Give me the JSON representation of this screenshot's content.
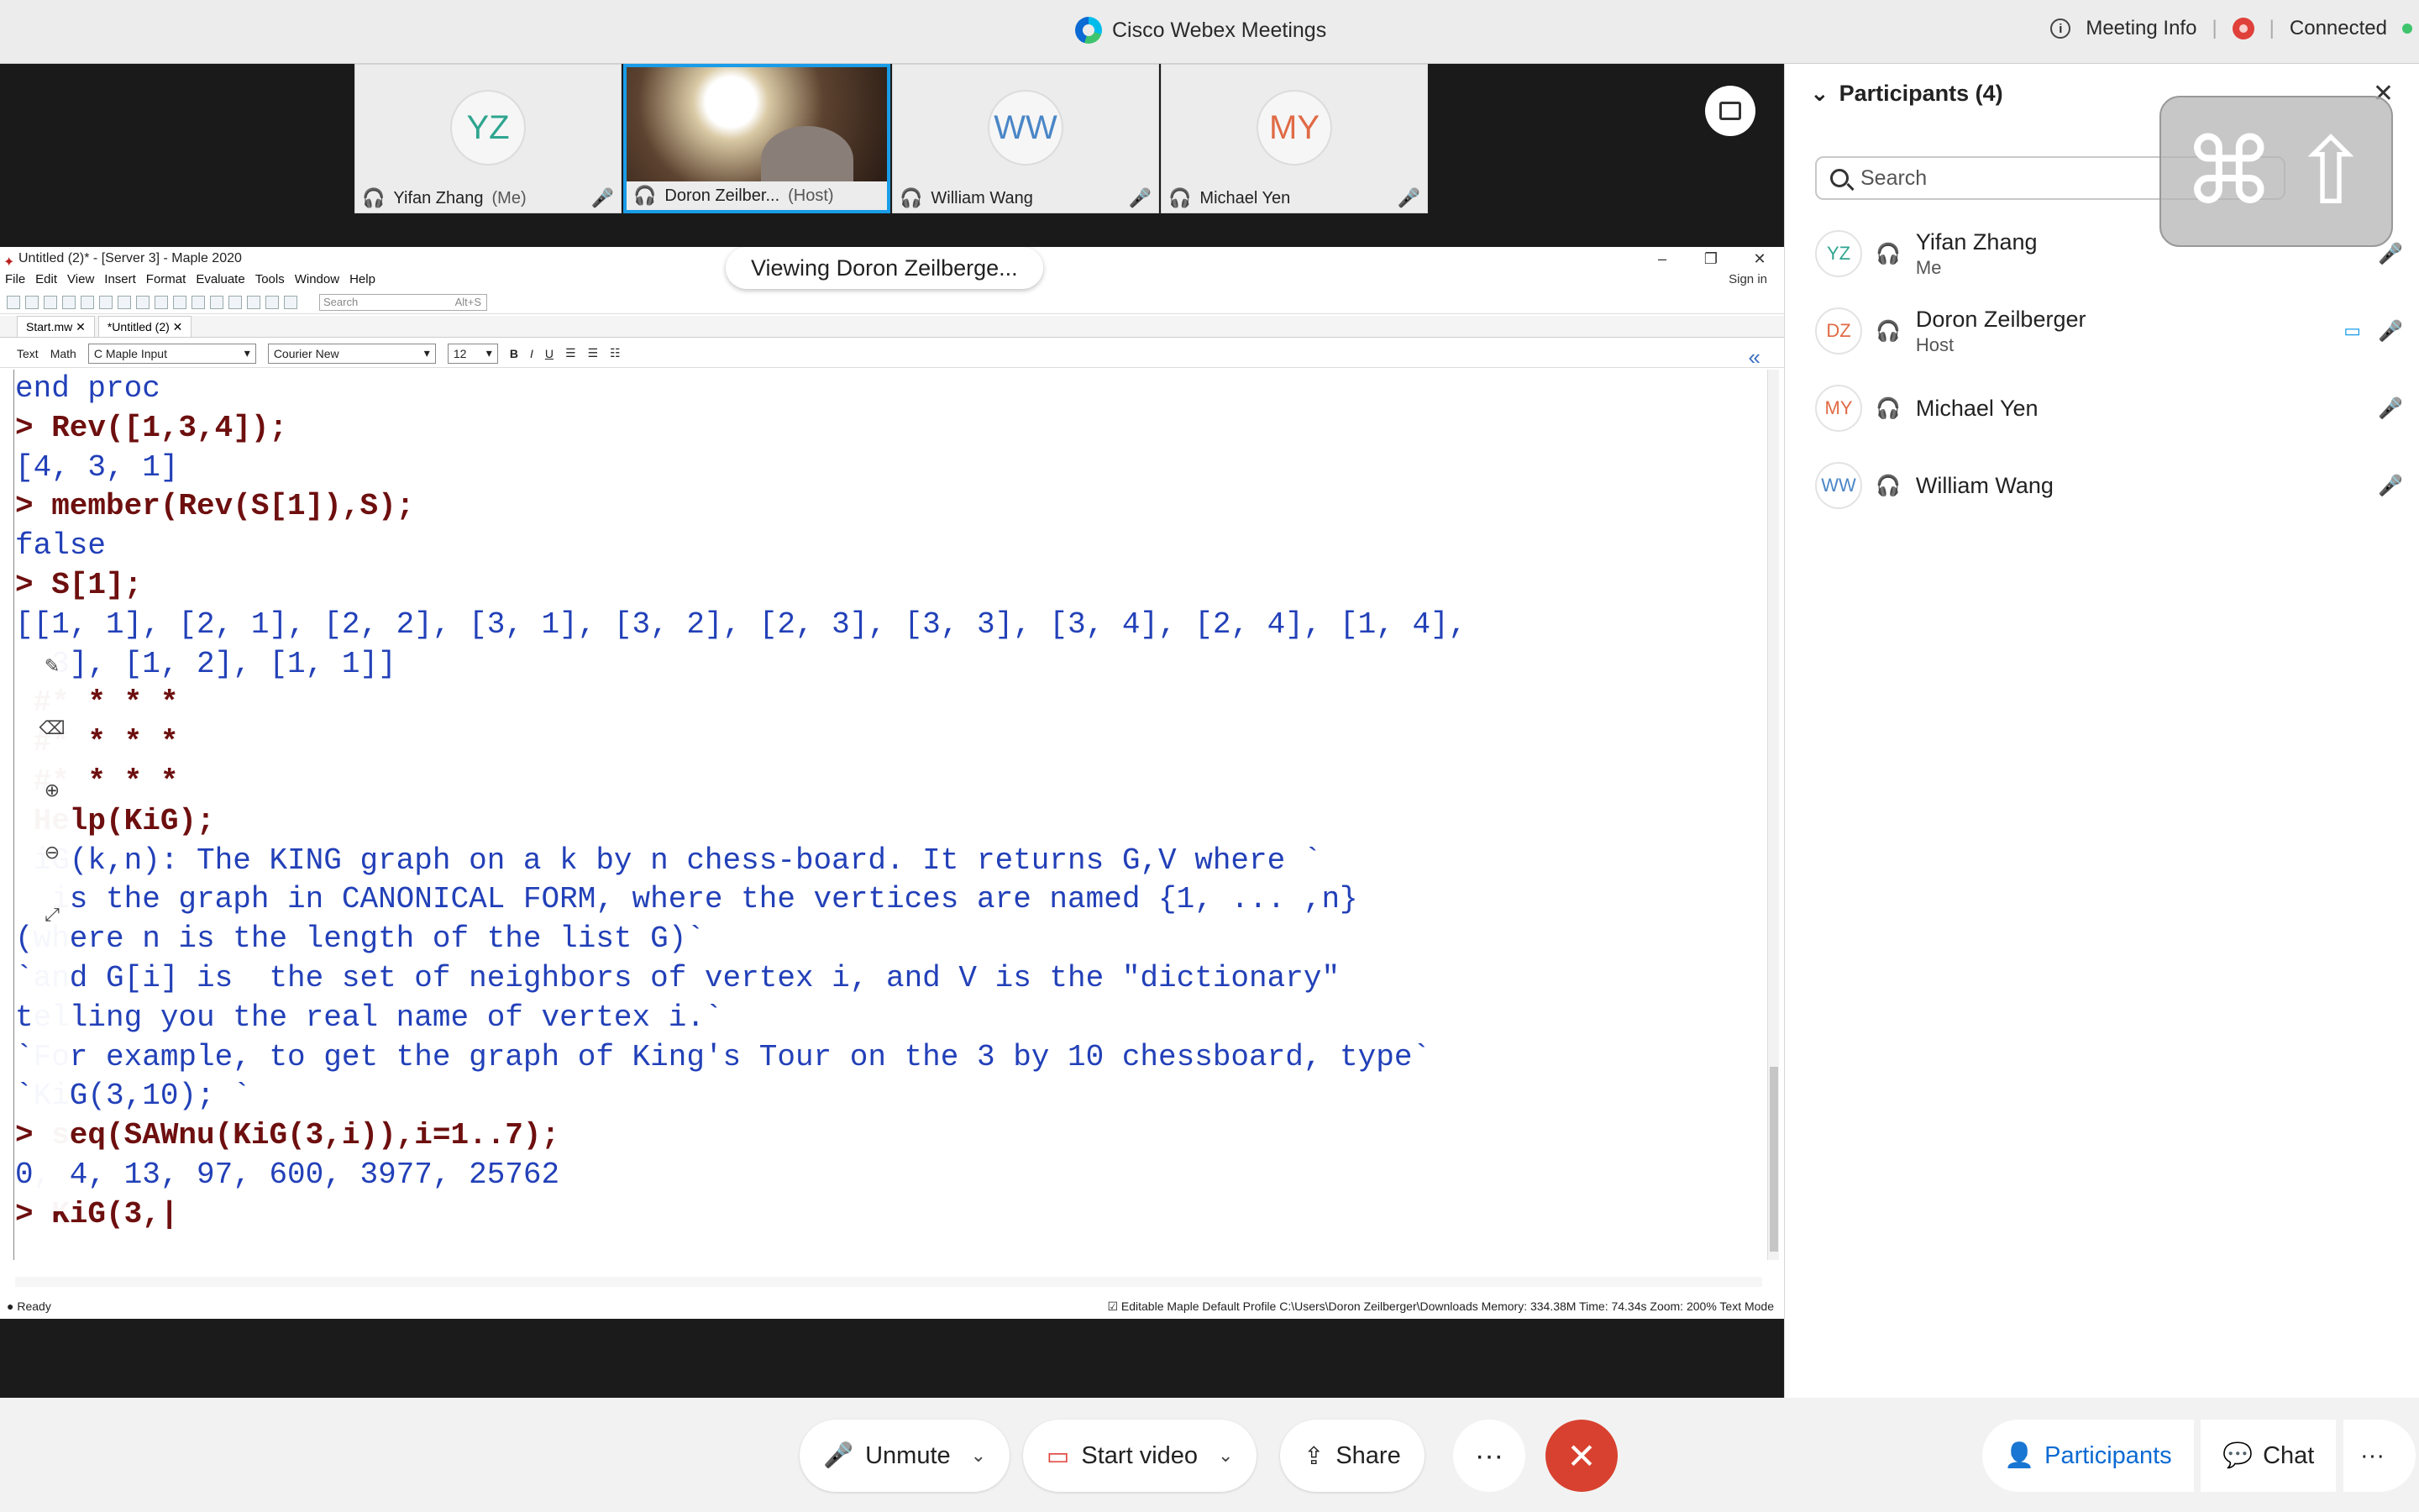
{
  "window": {
    "title": "Cisco Webex Meetings",
    "meeting_info": "Meeting Info",
    "status": "Connected"
  },
  "videos": [
    {
      "initials": "YZ",
      "name": "Yifan Zhang",
      "role": "(Me)",
      "color": "#2fa58f"
    },
    {
      "initials": "",
      "name": "Doron Zeilber...",
      "role": "(Host)",
      "color": ""
    },
    {
      "initials": "WW",
      "name": "William Wang",
      "role": "",
      "color": "#4a86c7"
    },
    {
      "initials": "MY",
      "name": "Michael Yen",
      "role": "",
      "color": "#e06a45"
    }
  ],
  "share": {
    "viewing_label": "Viewing Doron Zeilberge...",
    "maple_title": "Untitled (2)* - [Server 3] - Maple 2020",
    "menu": [
      "File",
      "Edit",
      "View",
      "Insert",
      "Format",
      "Evaluate",
      "Tools",
      "Window",
      "Help"
    ],
    "signin": "Sign in",
    "search_placeholder": "Search",
    "search_shortcut": "Alt+S",
    "tabs": [
      "Start.mw ✕",
      "*Untitled (2) ✕"
    ],
    "mode_text": "Text",
    "mode_math": "Math",
    "input_style": "C Maple Input",
    "font": "Courier New",
    "size": "12",
    "status_ready": "● Ready",
    "status_right": "☑ Editable    Maple Default Profile    C:\\Users\\Doron Zeilberger\\Downloads    Memory: 334.38M    Time: 74.34s    Zoom: 200%    Text Mode"
  },
  "worksheet": [
    {
      "type": "out",
      "text": "end proc"
    },
    {
      "type": "in",
      "text": "> Rev([1,3,4]);"
    },
    {
      "type": "out",
      "text": "[4, 3, 1]"
    },
    {
      "type": "in",
      "text": "> member(Rev(S[1]),S);"
    },
    {
      "type": "out",
      "text": "false"
    },
    {
      "type": "in",
      "text": "> S[1];"
    },
    {
      "type": "out",
      "text": "[[1, 1], [2, 1], [2, 2], [3, 1], [3, 2], [2, 3], [3, 3], [3, 4], [2, 4], [1, 4],"
    },
    {
      "type": "out",
      "text": "  3], [1, 2], [1, 1]]"
    },
    {
      "type": "in",
      "text": " #* * * *"
    },
    {
      "type": "in",
      "text": " #* * * *"
    },
    {
      "type": "in",
      "text": " #* * * *"
    },
    {
      "type": "in",
      "text": " Help(KiG);"
    },
    {
      "type": "out",
      "text": " iG(k,n): The KING graph on a k by n chess-board. It returns G,V where `"
    },
    {
      "type": "out",
      "text": "  is the graph in CANONICAL FORM, where the vertices are named {1, ... ,n}"
    },
    {
      "type": "out",
      "text": "(where n is the length of the list G)`"
    },
    {
      "type": "out",
      "text": "`and G[i] is  the set of neighbors of vertex i, and V is the \"dictionary\""
    },
    {
      "type": "out",
      "text": "telling you the real name of vertex i.`"
    },
    {
      "type": "out",
      "text": "`For example, to get the graph of King's Tour on the 3 by 10 chessboard, type`"
    },
    {
      "type": "out",
      "text": "`KiG(3,10); `"
    },
    {
      "type": "in",
      "text": "> seq(SAWnu(KiG(3,i)),i=1..7);"
    },
    {
      "type": "out",
      "text": "0, 4, 13, 97, 600, 3977, 25762"
    },
    {
      "type": "in",
      "text": "> KiG(3,|"
    }
  ],
  "panel": {
    "title": "Participants (4)",
    "search_placeholder": "Search",
    "participants": [
      {
        "initials": "YZ",
        "name": "Yifan Zhang",
        "role": "Me",
        "color": "#2fa58f",
        "mic": "muted"
      },
      {
        "initials": "DZ",
        "name": "Doron Zeilberger",
        "role": "Host",
        "color": "#e06a45",
        "mic": "active"
      },
      {
        "initials": "MY",
        "name": "Michael Yen",
        "role": "",
        "color": "#e06a45",
        "mic": "muted"
      },
      {
        "initials": "WW",
        "name": "William Wang",
        "role": "",
        "color": "#4a86c7",
        "mic": "muted"
      }
    ]
  },
  "controls": {
    "unmute": "Unmute",
    "start_video": "Start video",
    "share": "Share",
    "more": "···",
    "participants": "Participants",
    "chat": "Chat"
  }
}
